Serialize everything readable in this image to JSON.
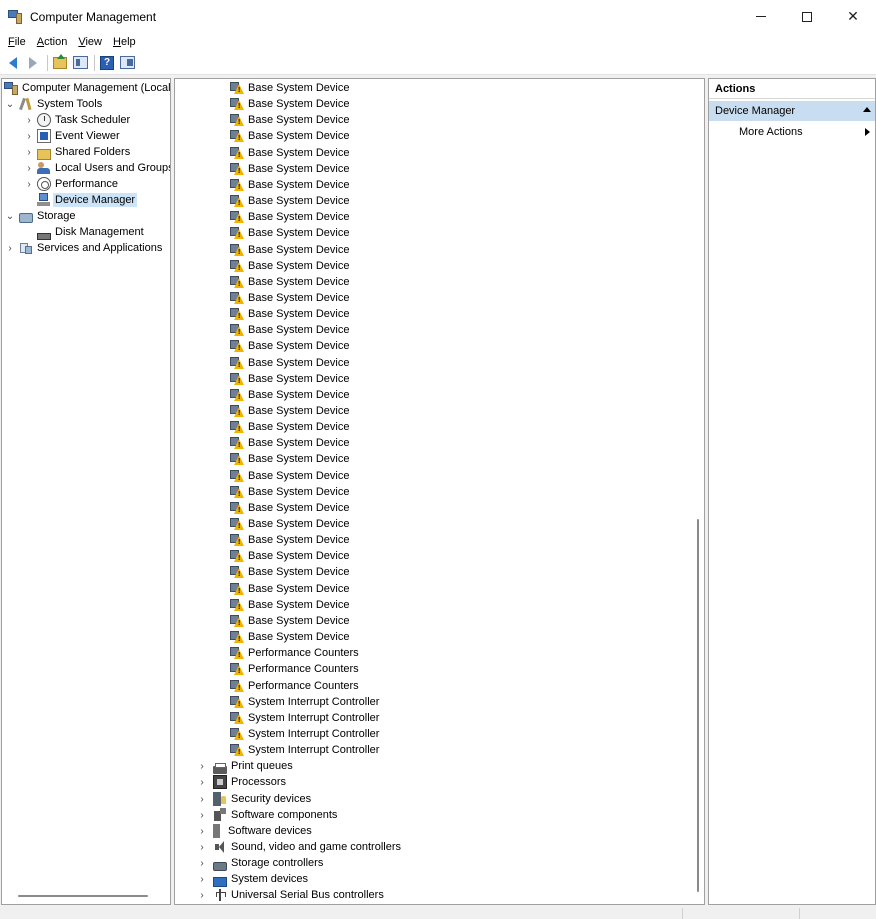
{
  "window": {
    "title": "Computer Management",
    "minimize_label": "–",
    "close_label": "✕"
  },
  "menu": {
    "items": [
      {
        "label": "File",
        "mnemonic": "F",
        "rest": "ile"
      },
      {
        "label": "Action",
        "mnemonic": "A",
        "rest": "ction"
      },
      {
        "label": "View",
        "mnemonic": "V",
        "rest": "iew"
      },
      {
        "label": "Help",
        "mnemonic": "H",
        "rest": "elp"
      }
    ]
  },
  "toolbar": {
    "buttons": [
      "back-arrow-icon",
      "forward-arrow-icon",
      "up-folder-icon",
      "show-hide-tree-icon",
      "help-icon",
      "show-hide-action-pane-icon"
    ],
    "help_glyph": "?"
  },
  "tree": {
    "root": "Computer Management (Local",
    "items": [
      {
        "label": "System Tools",
        "icon": "tools-icon"
      },
      {
        "label": "Task Scheduler",
        "icon": "clock-icon"
      },
      {
        "label": "Event Viewer",
        "icon": "event-viewer-icon"
      },
      {
        "label": "Shared Folders",
        "icon": "shared-folder-icon"
      },
      {
        "label": "Local Users and Groups",
        "icon": "users-icon"
      },
      {
        "label": "Performance",
        "icon": "performance-icon"
      },
      {
        "label": "Device Manager",
        "icon": "device-manager-icon",
        "selected": true
      },
      {
        "label": "Storage",
        "icon": "storage-icon"
      },
      {
        "label": "Disk Management",
        "icon": "disk-icon"
      },
      {
        "label": "Services and Applications",
        "icon": "services-icon"
      }
    ]
  },
  "devices": {
    "base_count_visible": 35,
    "items": [
      "Base System Device",
      "Base System Device",
      "Base System Device",
      "Base System Device",
      "Base System Device",
      "Base System Device",
      "Base System Device",
      "Base System Device",
      "Base System Device",
      "Base System Device",
      "Base System Device",
      "Base System Device",
      "Base System Device",
      "Base System Device",
      "Base System Device",
      "Base System Device",
      "Base System Device",
      "Base System Device",
      "Base System Device",
      "Base System Device",
      "Base System Device",
      "Base System Device",
      "Base System Device",
      "Base System Device",
      "Base System Device",
      "Base System Device",
      "Base System Device",
      "Base System Device",
      "Base System Device",
      "Base System Device",
      "Base System Device",
      "Base System Device",
      "Base System Device",
      "Base System Device",
      "Base System Device",
      "Performance Counters",
      "Performance Counters",
      "Performance Counters",
      "System Interrupt Controller",
      "System Interrupt Controller",
      "System Interrupt Controller",
      "System Interrupt Controller"
    ],
    "categories": [
      {
        "label": "Print queues",
        "icon": "printer-icon"
      },
      {
        "label": "Processors",
        "icon": "processor-icon"
      },
      {
        "label": "Security devices",
        "icon": "security-device-icon"
      },
      {
        "label": "Software components",
        "icon": "software-component-icon"
      },
      {
        "label": "Software devices",
        "icon": "software-device-icon"
      },
      {
        "label": "Sound, video and game controllers",
        "icon": "sound-icon"
      },
      {
        "label": "Storage controllers",
        "icon": "storage-controller-icon"
      },
      {
        "label": "System devices",
        "icon": "system-device-icon"
      },
      {
        "label": "Universal Serial Bus controllers",
        "icon": "usb-icon"
      }
    ]
  },
  "actions": {
    "header": "Actions",
    "section": "Device Manager",
    "items": [
      "More Actions"
    ]
  }
}
